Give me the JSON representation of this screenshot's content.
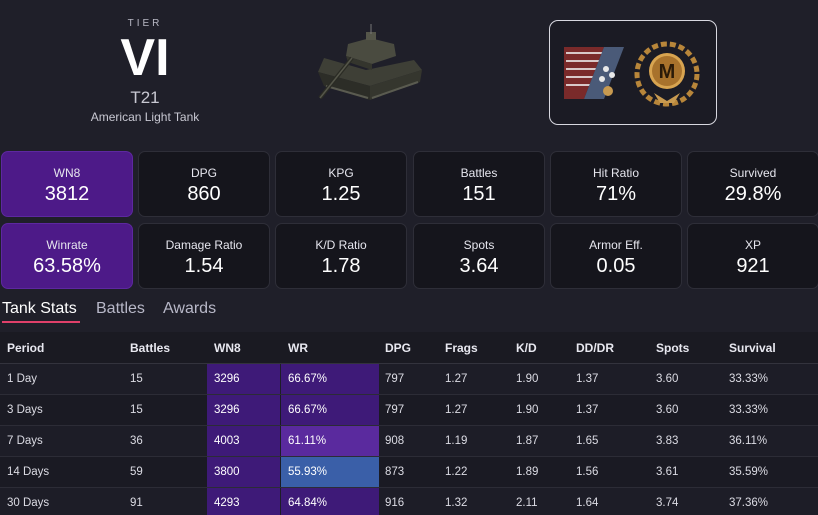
{
  "header": {
    "tier_label": "TIER",
    "tier_value": "VI",
    "tank_name": "T21",
    "tank_type": "American Light Tank",
    "tank_image_icon": "tank-image-icon",
    "awards": [
      {
        "icon": "us-flag-stars-badge-icon"
      },
      {
        "icon": "mastery-m-medal-icon",
        "letter": "M"
      }
    ]
  },
  "stats": [
    {
      "label": "WN8",
      "value": "3812",
      "highlight": true
    },
    {
      "label": "DPG",
      "value": "860"
    },
    {
      "label": "KPG",
      "value": "1.25"
    },
    {
      "label": "Battles",
      "value": "151"
    },
    {
      "label": "Hit Ratio",
      "value": "71%"
    },
    {
      "label": "Survived",
      "value": "29.8%"
    },
    {
      "label": "Winrate",
      "value": "63.58%",
      "highlight": true
    },
    {
      "label": "Damage Ratio",
      "value": "1.54"
    },
    {
      "label": "K/D Ratio",
      "value": "1.78"
    },
    {
      "label": "Spots",
      "value": "3.64"
    },
    {
      "label": "Armor Eff.",
      "value": "0.05"
    },
    {
      "label": "XP",
      "value": "921"
    }
  ],
  "tabs": [
    {
      "label": "Tank Stats",
      "active": true
    },
    {
      "label": "Battles"
    },
    {
      "label": "Awards"
    }
  ],
  "table": {
    "columns": [
      "Period",
      "Battles",
      "WN8",
      "WR",
      "DPG",
      "Frags",
      "K/D",
      "DD/DR",
      "Spots",
      "Survival"
    ],
    "rows": [
      {
        "period": "1 Day",
        "battles": "15",
        "wn8": "3296",
        "wr": "66.67%",
        "dpg": "797",
        "frags": "1.27",
        "kd": "1.90",
        "dddr": "1.37",
        "spots": "3.60",
        "survival": "33.33%",
        "wn8_color": "#3e1a78",
        "wr_color": "#3e1a78"
      },
      {
        "period": "3 Days",
        "battles": "15",
        "wn8": "3296",
        "wr": "66.67%",
        "dpg": "797",
        "frags": "1.27",
        "kd": "1.90",
        "dddr": "1.37",
        "spots": "3.60",
        "survival": "33.33%",
        "wn8_color": "#3e1a78",
        "wr_color": "#3e1a78"
      },
      {
        "period": "7 Days",
        "battles": "36",
        "wn8": "4003",
        "wr": "61.11%",
        "dpg": "908",
        "frags": "1.19",
        "kd": "1.87",
        "dddr": "1.65",
        "spots": "3.83",
        "survival": "36.11%",
        "wn8_color": "#3e1a78",
        "wr_color": "#5a2a9e"
      },
      {
        "period": "14 Days",
        "battles": "59",
        "wn8": "3800",
        "wr": "55.93%",
        "dpg": "873",
        "frags": "1.22",
        "kd": "1.89",
        "dddr": "1.56",
        "spots": "3.61",
        "survival": "35.59%",
        "wn8_color": "#3e1a78",
        "wr_color": "#3a5fa8"
      },
      {
        "period": "30 Days",
        "battles": "91",
        "wn8": "4293",
        "wr": "64.84%",
        "dpg": "916",
        "frags": "1.32",
        "kd": "2.11",
        "dddr": "1.64",
        "spots": "3.74",
        "survival": "37.36%",
        "wn8_color": "#3e1a78",
        "wr_color": "#3e1a78"
      }
    ]
  }
}
